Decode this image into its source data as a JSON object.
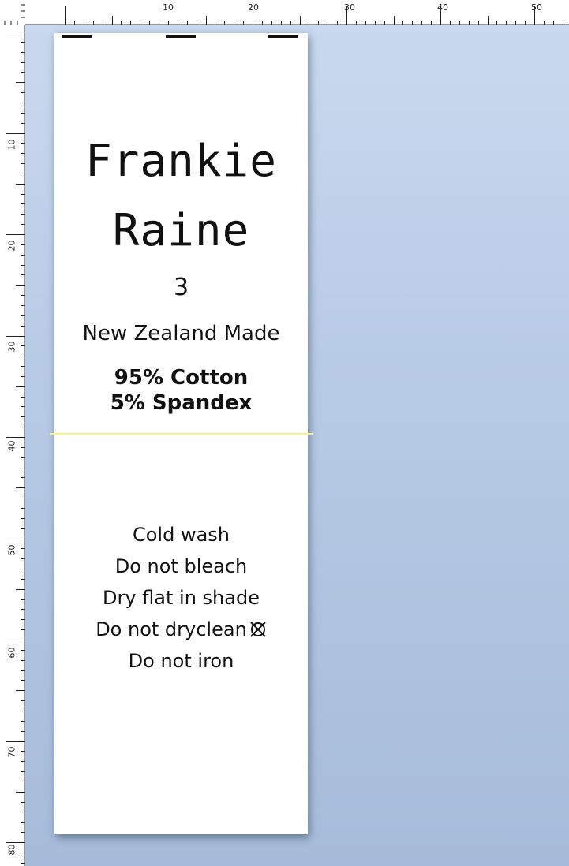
{
  "ruler": {
    "top_labels": [
      "10",
      "20",
      "30",
      "40",
      "50"
    ],
    "left_labels": [
      "10",
      "20",
      "30",
      "40",
      "50",
      "60",
      "70",
      "80"
    ]
  },
  "label": {
    "brand_line1": "Frankie",
    "brand_line2": "Raine",
    "size": "3",
    "origin": "New Zealand Made",
    "composition_line1": "95% Cotton",
    "composition_line2": "5% Spandex",
    "care": {
      "line1": "Cold wash",
      "line2": "Do not bleach",
      "line3": "Dry flat in shade",
      "line4": "Do not dryclean",
      "line5": "Do not iron"
    },
    "care_icon": "do-not-dryclean-icon"
  },
  "colors": {
    "fold_line": "#f4f09a",
    "workspace_top": "#c9d9ef",
    "workspace_bottom": "#a7bcda"
  }
}
